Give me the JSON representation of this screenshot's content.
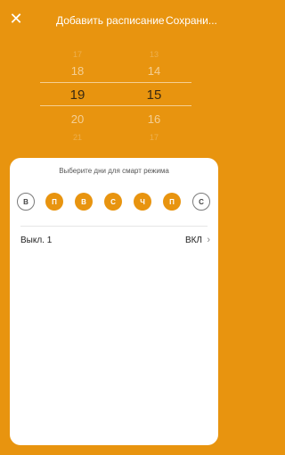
{
  "header": {
    "close_icon": "close-icon",
    "title": "Добавить расписание",
    "save_label": "Сохрани..."
  },
  "picker": {
    "hours": [
      "17",
      "18",
      "19",
      "20",
      "21"
    ],
    "minutes": [
      "13",
      "14",
      "15",
      "16",
      "17"
    ],
    "selected_hour": "19",
    "selected_minute": "15"
  },
  "sheet": {
    "title": "Выберите дни для смарт режима",
    "days": [
      {
        "label": "В",
        "selected": false
      },
      {
        "label": "П",
        "selected": true
      },
      {
        "label": "В",
        "selected": true
      },
      {
        "label": "С",
        "selected": true
      },
      {
        "label": "Ч",
        "selected": true
      },
      {
        "label": "П",
        "selected": true
      },
      {
        "label": "С",
        "selected": false
      }
    ],
    "setting_row": {
      "label": "Выкл. 1",
      "value": "ВКЛ",
      "chevron_icon": "chevron-right-icon"
    }
  },
  "colors": {
    "accent": "#e8940f",
    "sheet_bg": "#ffffff"
  }
}
